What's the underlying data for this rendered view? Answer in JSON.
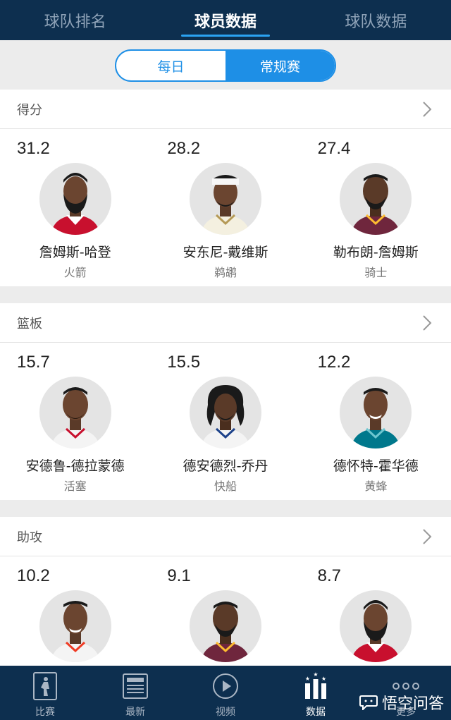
{
  "tabs": [
    "球队排名",
    "球员数据",
    "球队数据"
  ],
  "segment": {
    "daily": "每日",
    "regular": "常规赛"
  },
  "sections": [
    {
      "title": "得分",
      "players": [
        {
          "value": "31.2",
          "name": "詹姆斯-哈登",
          "team": "火箭"
        },
        {
          "value": "28.2",
          "name": "安东尼-戴维斯",
          "team": "鹈鹕"
        },
        {
          "value": "27.4",
          "name": "勒布朗-詹姆斯",
          "team": "骑士"
        }
      ]
    },
    {
      "title": "篮板",
      "players": [
        {
          "value": "15.7",
          "name": "安德鲁-德拉蒙德",
          "team": "活塞"
        },
        {
          "value": "15.5",
          "name": "德安德烈-乔丹",
          "team": "快船"
        },
        {
          "value": "12.2",
          "name": "德怀特-霍华德",
          "team": "黄蜂"
        }
      ]
    },
    {
      "title": "助攻",
      "players": [
        {
          "value": "10.2",
          "name": "",
          "team": ""
        },
        {
          "value": "9.1",
          "name": "",
          "team": ""
        },
        {
          "value": "8.7",
          "name": "",
          "team": ""
        }
      ]
    }
  ],
  "nav": [
    "比赛",
    "最新",
    "视频",
    "数据",
    "更多"
  ],
  "watermark": "悟空问答",
  "colors": {
    "navy": "#0d2f4f",
    "accent": "#1e8fe6"
  }
}
